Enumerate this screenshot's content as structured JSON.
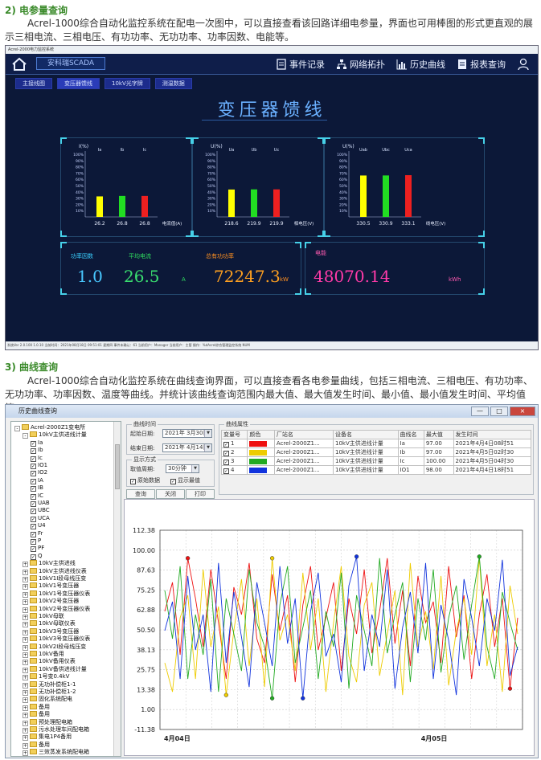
{
  "section1": {
    "heading": "2) 电参量查询",
    "paragraph": "Acrel-1000综合自动化监控系统在配电一次图中，可以直接查看该回路详细电参量，界面也可用棒图的形式更直观的展示三相电流、三相电压、有功功率、无功功率、功率因数、电能等。"
  },
  "section2": {
    "heading": "3) 曲线查询",
    "paragraph": "Acrel-1000综合自动化监控系统在曲线查询界面，可以直接查看各电参量曲线，包括三相电流、三相电压、有功功率、无功功率、功率因数、温度等曲线。并统计该曲线查询范围内最大值、最大值发生时间、最小值、最小值发生时间、平均值等。"
  },
  "scada": {
    "window_title": "Acrel-2000电力监控系统",
    "brand": "安科瑞SCADA",
    "nav": [
      {
        "label": "事件记录",
        "icon": "event-log-icon"
      },
      {
        "label": "网络拓扑",
        "icon": "network-topology-icon"
      },
      {
        "label": "历史曲线",
        "icon": "history-curve-icon"
      },
      {
        "label": "报表查询",
        "icon": "report-query-icon"
      }
    ],
    "tabs": [
      "主接线图",
      "变压器馈线",
      "10kV光字牌",
      "测温数据"
    ],
    "page_title": "变压器馈线",
    "statusbar": "系统Ver 2.0.100 1.0.10    当前时间：2021年08月18日 09:51:01  星期四      事件未确认：61    当前用户：Manager    当前用户：主管    操作：%dAcrel综合管理监控系统    NUM",
    "current_chart": {
      "title": "I(%)",
      "labels": [
        "Ia",
        "Ib",
        "Ic"
      ],
      "values": [
        26.2,
        26.8,
        26.8
      ],
      "unit": "电流值(A)",
      "colors": [
        "#ffff00",
        "#22dd22",
        "#ee2020"
      ]
    },
    "voltage_chart": {
      "title": "U(%)",
      "labels": [
        "Ua",
        "Ub",
        "Uc"
      ],
      "values": [
        218.6,
        219.9,
        219.9
      ],
      "unit": "相电压(V)",
      "colors": [
        "#ffff00",
        "#22dd22",
        "#ee2020"
      ]
    },
    "line_voltage_chart": {
      "title": "U(%)",
      "labels": [
        "Uab",
        "Ubc",
        "Uca"
      ],
      "values": [
        330.5,
        330.9,
        333.1
      ],
      "unit": "线电压(V)",
      "colors": [
        "#ffff00",
        "#22dd22",
        "#ee2020"
      ]
    },
    "yticks": [
      "100%",
      "90%",
      "80%",
      "70%",
      "60%",
      "50%",
      "40%",
      "30%",
      "20%",
      "10%"
    ],
    "metrics": {
      "pf_label": "功率因数",
      "pf_value": "1.0",
      "avg_current_label": "平均电流",
      "avg_current_value": "26.5",
      "avg_current_unit": "A",
      "active_power_label": "总有功功率",
      "active_power_value": "72247.3",
      "active_power_unit": "kW",
      "energy_label": "电能",
      "energy_value": "48070.14",
      "energy_unit": "kWh"
    },
    "colors": {
      "pf": "#48c8ff",
      "avg": "#3ae070",
      "power": "#ffa020",
      "energy": "#ff3aa8",
      "label_cyan": "#3ad0ff",
      "label_green": "#30e060",
      "label_orange": "#ff9020",
      "label_pink": "#ff5ab0"
    }
  },
  "history": {
    "window_title": "历史曲线查询",
    "window_buttons": [
      "—",
      "□",
      "×"
    ],
    "tree": [
      {
        "depth": 0,
        "type": "folder",
        "expander": "-",
        "label": "Acrel-2000Z1变电所"
      },
      {
        "depth": 1,
        "type": "folder",
        "expander": "-",
        "label": "10kV主供进线计量"
      },
      {
        "depth": 2,
        "type": "check",
        "label": "Ia"
      },
      {
        "depth": 2,
        "type": "check",
        "label": "Ib"
      },
      {
        "depth": 2,
        "type": "check",
        "label": "Ic"
      },
      {
        "depth": 2,
        "type": "check",
        "label": "IO1"
      },
      {
        "depth": 2,
        "type": "check",
        "label": "IO2"
      },
      {
        "depth": 2,
        "type": "check",
        "label": "IA"
      },
      {
        "depth": 2,
        "type": "check",
        "label": "IB"
      },
      {
        "depth": 2,
        "type": "check",
        "label": "IC"
      },
      {
        "depth": 2,
        "type": "check",
        "label": "UAB"
      },
      {
        "depth": 2,
        "type": "check",
        "label": "UBC"
      },
      {
        "depth": 2,
        "type": "check",
        "label": "UCA"
      },
      {
        "depth": 2,
        "type": "check",
        "label": "U4"
      },
      {
        "depth": 2,
        "type": "check",
        "label": "Fr"
      },
      {
        "depth": 2,
        "type": "check",
        "label": "P"
      },
      {
        "depth": 2,
        "type": "check",
        "label": "PF"
      },
      {
        "depth": 2,
        "type": "check",
        "label": "Q"
      },
      {
        "depth": 1,
        "type": "folder",
        "expander": "+",
        "label": "10kV主供进线"
      },
      {
        "depth": 1,
        "type": "folder",
        "expander": "+",
        "label": "10kV主供进线仪表"
      },
      {
        "depth": 1,
        "type": "folder",
        "expander": "+",
        "label": "10kV1I段母线压变"
      },
      {
        "depth": 1,
        "type": "folder",
        "expander": "+",
        "label": "10kV1号变压器"
      },
      {
        "depth": 1,
        "type": "folder",
        "expander": "+",
        "label": "10kV1号变压器仪表"
      },
      {
        "depth": 1,
        "type": "folder",
        "expander": "+",
        "label": "10kV2号变压器"
      },
      {
        "depth": 1,
        "type": "folder",
        "expander": "+",
        "label": "10kV2号变压器仪表"
      },
      {
        "depth": 1,
        "type": "folder",
        "expander": "+",
        "label": "10kV母联"
      },
      {
        "depth": 1,
        "type": "folder",
        "expander": "+",
        "label": "10kV母联仪表"
      },
      {
        "depth": 1,
        "type": "folder",
        "expander": "+",
        "label": "10kV3号变压器"
      },
      {
        "depth": 1,
        "type": "folder",
        "expander": "+",
        "label": "10kV3号变压器仪表"
      },
      {
        "depth": 1,
        "type": "folder",
        "expander": "+",
        "label": "10kV2I段母线压变"
      },
      {
        "depth": 1,
        "type": "folder",
        "expander": "+",
        "label": "10kV备用"
      },
      {
        "depth": 1,
        "type": "folder",
        "expander": "+",
        "label": "10kV备用仪表"
      },
      {
        "depth": 1,
        "type": "folder",
        "expander": "+",
        "label": "10kV备供进线计量"
      },
      {
        "depth": 1,
        "type": "folder",
        "expander": "+",
        "label": "1号变0.4kV"
      },
      {
        "depth": 1,
        "type": "folder",
        "expander": "+",
        "label": "无功补偿柜1-1"
      },
      {
        "depth": 1,
        "type": "folder",
        "expander": "+",
        "label": "无功补偿柜1-2"
      },
      {
        "depth": 1,
        "type": "folder",
        "expander": "+",
        "label": "固化系统配电"
      },
      {
        "depth": 1,
        "type": "folder",
        "expander": "+",
        "label": "备用"
      },
      {
        "depth": 1,
        "type": "folder",
        "expander": "+",
        "label": "备用"
      },
      {
        "depth": 1,
        "type": "folder",
        "expander": "+",
        "label": "预处理配电箱"
      },
      {
        "depth": 1,
        "type": "folder",
        "expander": "+",
        "label": "污水处理车间配电箱"
      },
      {
        "depth": 1,
        "type": "folder",
        "expander": "+",
        "label": "集电1P4备用"
      },
      {
        "depth": 1,
        "type": "folder",
        "expander": "+",
        "label": "备用"
      },
      {
        "depth": 1,
        "type": "folder",
        "expander": "+",
        "label": "三效蒸发系统配电箱"
      }
    ],
    "time_group": {
      "legend": "曲线时间",
      "start_label": "起始日期:",
      "start_value": "2021年 3月30日",
      "end_label": "结束日期:",
      "end_value": "2021年 4月14日"
    },
    "display_group": {
      "legend": "显示方式",
      "period_label": "取值周期:",
      "period_value": "30分钟",
      "cb1": "原始数据",
      "cb2": "显示最值"
    },
    "buttons": [
      "查询",
      "关闭",
      "打印"
    ],
    "attr_group": {
      "legend": "曲线属性",
      "columns": [
        "变量号",
        "颜色",
        "厂站名",
        "设备名",
        "曲线名",
        "最大值",
        "发生时间"
      ],
      "rows": [
        {
          "id": "1",
          "color": "#ee1111",
          "station": "Acrel-2000Z1...",
          "device": "10kV主供进线计量",
          "curve": "Ia",
          "max": "97.00",
          "time": "2021年4月4日08时51"
        },
        {
          "id": "2",
          "color": "#eecc00",
          "station": "Acrel-2000Z1...",
          "device": "10kV主供进线计量",
          "curve": "Ib",
          "max": "97.00",
          "time": "2021年4月5日02时30"
        },
        {
          "id": "3",
          "color": "#22aa22",
          "station": "Acrel-2000Z1...",
          "device": "10kV主供进线计量",
          "curve": "Ic",
          "max": "100.00",
          "time": "2021年4月5日04时30"
        },
        {
          "id": "4",
          "color": "#1133dd",
          "station": "Acrel-2000Z1...",
          "device": "10kV主供进线计量",
          "curve": "IO1",
          "max": "98.00",
          "time": "2021年4月4日18时51"
        }
      ]
    }
  },
  "chart_data": [
    {
      "type": "bar",
      "title": "I(%)",
      "categories": [
        "Ia",
        "Ib",
        "Ic"
      ],
      "values": [
        26.2,
        26.8,
        26.8
      ],
      "xlabel": "电流值(A)",
      "ylim": [
        0,
        100
      ]
    },
    {
      "type": "bar",
      "title": "U(%)",
      "categories": [
        "Ua",
        "Ub",
        "Uc"
      ],
      "values": [
        218.6,
        219.9,
        219.9
      ],
      "xlabel": "相电压(V)"
    },
    {
      "type": "bar",
      "title": "U(%)",
      "categories": [
        "Uab",
        "Ubc",
        "Uca"
      ],
      "values": [
        330.5,
        330.9,
        333.1
      ],
      "xlabel": "线电压(V)"
    },
    {
      "type": "line",
      "yticks": [
        "112.38",
        "100.00",
        "87.63",
        "75.25",
        "62.88",
        "50.50",
        "38.13",
        "25.75",
        "13.38",
        "1.00",
        "-11.38"
      ],
      "ylim": [
        -11.38,
        112.38
      ],
      "xticks": [
        "4月04日",
        "4月05日"
      ],
      "grid": true,
      "series": [
        {
          "name": "Ia",
          "color": "#ee1111",
          "values": [
            62,
            80,
            35,
            95,
            70,
            40,
            88,
            55,
            20,
            77,
            60,
            92,
            45,
            30,
            85,
            50,
            72,
            18,
            66,
            90,
            38,
            58,
            80,
            25,
            70,
            48,
            88,
            36,
            62,
            95,
            42,
            75,
            28,
            84,
            55,
            68,
            30,
            90,
            46,
            72,
            20,
            60,
            85,
            40,
            70,
            14,
            58
          ]
        },
        {
          "name": "Ib",
          "color": "#eecc00",
          "values": [
            30,
            12,
            58,
            72,
            20,
            88,
            40,
            65,
            10,
            50,
            82,
            28,
            70,
            15,
            95,
            44,
            60,
            25,
            86,
            38,
            70,
            12,
            55,
            90,
            34,
            18,
            66,
            80,
            22,
            48,
            75,
            10,
            92,
            40,
            62,
            26,
            84,
            16,
            50,
            70,
            35,
            95,
            28,
            60,
            12,
            78,
            48
          ]
        },
        {
          "name": "Ic",
          "color": "#22aa22",
          "values": [
            75,
            45,
            90,
            20,
            60,
            35,
            82,
            12,
            70,
            48,
            25,
            88,
            55,
            40,
            8,
            66,
            90,
            30,
            52,
            75,
            20,
            62,
            40,
            86,
            14,
            72,
            50,
            28,
            95,
            36,
            60,
            80,
            18,
            70,
            44,
            88,
            24,
            58,
            78,
            32,
            66,
            96,
            40,
            20,
            74,
            55,
            38
          ]
        },
        {
          "name": "IO1",
          "color": "#1133dd",
          "values": [
            50,
            68,
            20,
            84,
            38,
            60,
            12,
            92,
            30,
            74,
            46,
            15,
            80,
            55,
            28,
            90,
            42,
            70,
            8,
            62,
            86,
            34,
            48,
            18,
            78,
            96,
            25,
            60,
            40,
            88,
            14,
            52,
            74,
            36,
            92,
            20,
            66,
            44,
            10,
            82,
            58,
            28,
            70,
            50,
            94,
            22,
            40
          ]
        }
      ]
    }
  ]
}
